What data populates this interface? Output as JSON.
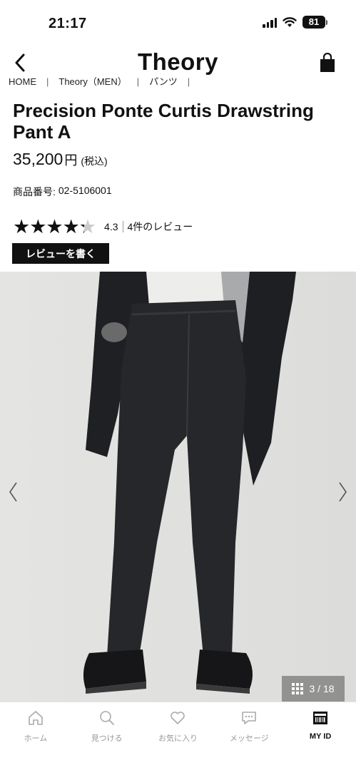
{
  "status_bar": {
    "time": "21:17",
    "battery": "81"
  },
  "header": {
    "brand": "Theory",
    "back_icon": "chevron-left-icon",
    "bag_icon": "shopping-bag-icon"
  },
  "breadcrumb": {
    "items": [
      "HOME",
      "Theory（MEN）",
      "パンツ"
    ],
    "separator": "|"
  },
  "product": {
    "title": "Precision Ponte Curtis Drawstring Pant A",
    "price": "35,200",
    "price_unit": "円",
    "tax_note": "(税込)",
    "sku_label": "商品番号:",
    "sku_value": "02-5106001",
    "rating": 4.3,
    "rating_text": "4.3",
    "review_count_text": "4件のレビュー",
    "write_review_label": "レビューを書く"
  },
  "gallery": {
    "counter": "3 / 18",
    "current": 3,
    "total": 18
  },
  "tabbar": {
    "items": [
      {
        "label": "ホーム",
        "icon": "home-icon",
        "active": false
      },
      {
        "label": "見つける",
        "icon": "search-icon",
        "active": false
      },
      {
        "label": "お気に入り",
        "icon": "heart-icon",
        "active": false
      },
      {
        "label": "メッセージ",
        "icon": "message-icon",
        "active": false
      },
      {
        "label": "MY ID",
        "icon": "id-card-icon",
        "active": true
      }
    ]
  }
}
